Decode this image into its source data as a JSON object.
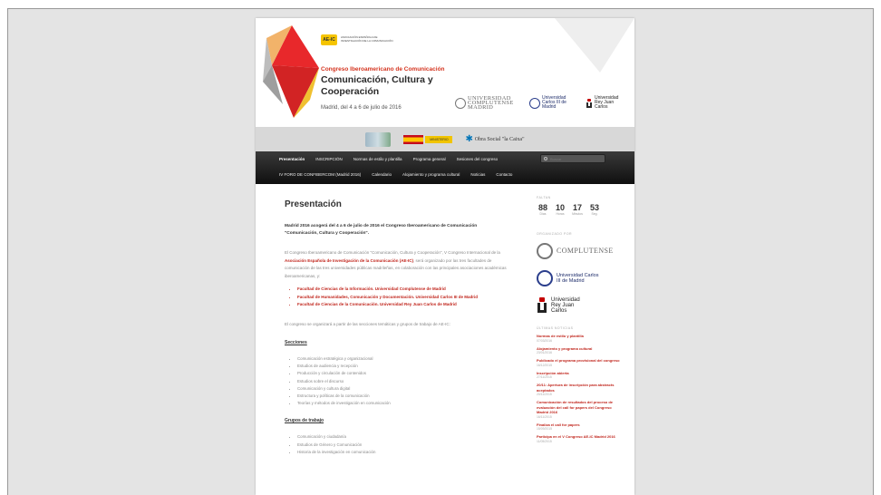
{
  "header": {
    "logo_mark": "AE-IC",
    "logo_text": "ASOCIACIÓN ESPAÑOLA DE INVESTIGACIÓN DE LA COMUNICACIÓN",
    "congress_title": "Congreso Iberoamericano de Comunicación",
    "main_title": "Comunicación, Cultura y Cooperación",
    "date_line": "Madrid, del 4 a 6 de julio de 2016",
    "universities": [
      {
        "name": "UNIVERSIDAD COMPLUTENSE MADRID"
      },
      {
        "name": "Universidad Carlos III de Madrid"
      },
      {
        "name": "Universidad Rey Juan Carlos"
      }
    ]
  },
  "sponsors": {
    "ministry_text": "MINISTERIO",
    "obra_social": "Obra Social \"la Caixa\""
  },
  "nav": {
    "row1": [
      "Presentación",
      "INSCRIPCIÓN",
      "Normas de estilo y plantilla",
      "Programa general",
      "Sesiones del congreso"
    ],
    "row2": [
      "IV FORO DE CONFIBERCOM (Madrid 2016)",
      "Calendario",
      "Alojamiento y programa cultural",
      "Noticias",
      "Contacto"
    ],
    "search_placeholder": "Buscar"
  },
  "content": {
    "title": "Presentación",
    "lead": "Madrid 2016 acogerá del 4 a 6 de julio de 2016 el Congreso Iberoamericano de Comunicación \"Comunicación, Cultura y Cooperación\".",
    "p1_a": "El Congreso Iberoamericano de Comunicación \"Comunicación, Cultura y Cooperación\", V Congreso Internacional de la ",
    "p1_link": "Asociación Española de Investigación de la Comunicación (AE-IC)",
    "p1_b": ", será organizado por las tres facultades de comunicación de las tres universidades públicas madrileñas, en colaboración con las principales asociaciones académicas iberoamericanas, y:",
    "faculties": [
      "Facultad de Ciencias de la Información. Universidad Complutense de Madrid",
      "Facultad de Humanidades, Comunicación y Documentación. Universidad Carlos III de Madrid",
      "Facultad de Ciencias de la Comunicación. Universidad Rey Juan Carlos de Madrid"
    ],
    "p2": "El congreso se organizará a partir de las secciones temáticas y grupos de trabajo de AE-IC:",
    "sections_title": "Secciones",
    "sections": [
      "Comunicación estratégica y organizacional",
      "Estudios de audiencia y recepción",
      "Producción y circulación de contenidos",
      "Estudios sobre el discurso",
      "Comunicación y cultura digital",
      "Estructura y políticas de la comunicación",
      "Teorías y métodos de investigación en comunicación"
    ],
    "groups_title": "Grupos de trabajo",
    "groups": [
      "Comunicación y ciudadanía",
      "Estudios de Género y Comunicación",
      "Historia de la investigación en comunicación"
    ]
  },
  "sidebar": {
    "countdown_head": "FALTAN",
    "countdown": [
      {
        "value": "88",
        "label": "Días"
      },
      {
        "value": "10",
        "label": "Horas"
      },
      {
        "value": "17",
        "label": "Minutos"
      },
      {
        "value": "53",
        "label": "Seg."
      }
    ],
    "organizers_head": "ORGANIZADO POR",
    "organizers": [
      {
        "name": "COMPLUTENSE"
      },
      {
        "name": "Universidad Carlos III de Madrid"
      },
      {
        "name": "Universidad Rey Juan Carlos"
      }
    ],
    "news_head": "ÚLTIMAS NOTICIAS",
    "news": [
      {
        "title": "Normas de estilo y plantilla",
        "date": "07/03/2016"
      },
      {
        "title": "Alojamiento y programa cultural",
        "date": "23/01/2016"
      },
      {
        "title": "Publicado el programa provisional del congreso",
        "date": "16/12/2015"
      },
      {
        "title": "Inscripción abierta",
        "date": "27/11/2015"
      },
      {
        "title": "20/11: Apertura de inscripción para abstracts aceptados",
        "date": "20/11/2015"
      },
      {
        "title": "Comunicación de resultados del proceso de evaluación del call for papers del Congreso Madrid 2016",
        "date": "16/11/2015"
      },
      {
        "title": "Finaliza el call for papers",
        "date": "15/09/2015"
      },
      {
        "title": "Participa en el V Congreso AE-IC Madrid 2016",
        "date": "11/05/2015"
      }
    ]
  },
  "colors": {
    "accent_red": "#c0241b",
    "nav_bg": "#1a1a1a",
    "sponsor_bar": "#d8d8d8"
  }
}
